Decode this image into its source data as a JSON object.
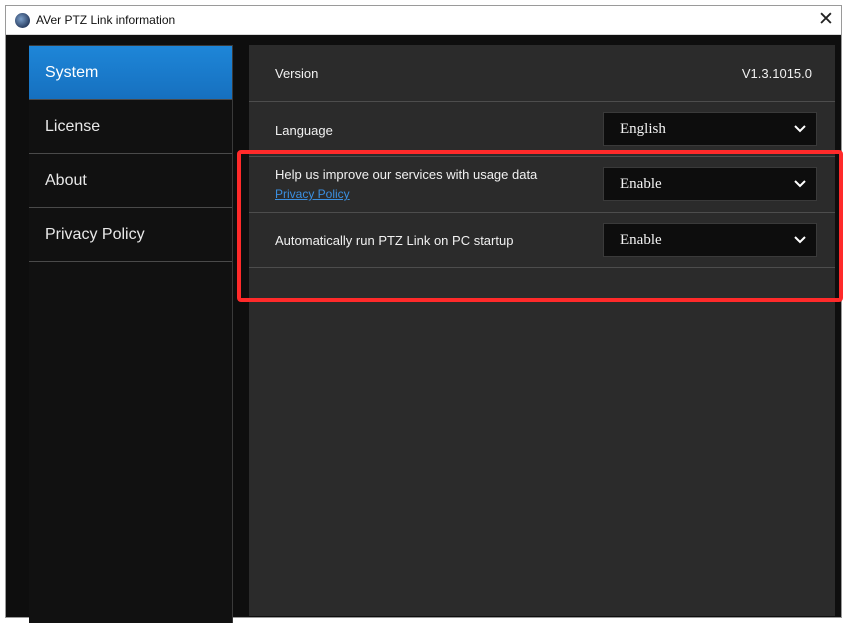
{
  "window": {
    "title": "AVer PTZ Link information",
    "close_glyph": "✕",
    "app_icon": "globe-icon"
  },
  "sidebar": {
    "items": [
      {
        "label": "System",
        "active": true
      },
      {
        "label": "License",
        "active": false
      },
      {
        "label": "About",
        "active": false
      },
      {
        "label": "Privacy Policy",
        "active": false
      }
    ]
  },
  "settings": {
    "version_label": "Version",
    "version_value": "V1.3.1015.0",
    "language_label": "Language",
    "language_value": "English",
    "usage_label": "Help us improve our services with usage data",
    "privacy_link": "Privacy Policy",
    "usage_value": "Enable",
    "startup_label": "Automatically run PTZ Link on PC startup",
    "startup_value": "Enable"
  },
  "colors": {
    "accent": "#1e86d8",
    "highlight": "#ff2a2a",
    "link": "#3b8fe0"
  }
}
